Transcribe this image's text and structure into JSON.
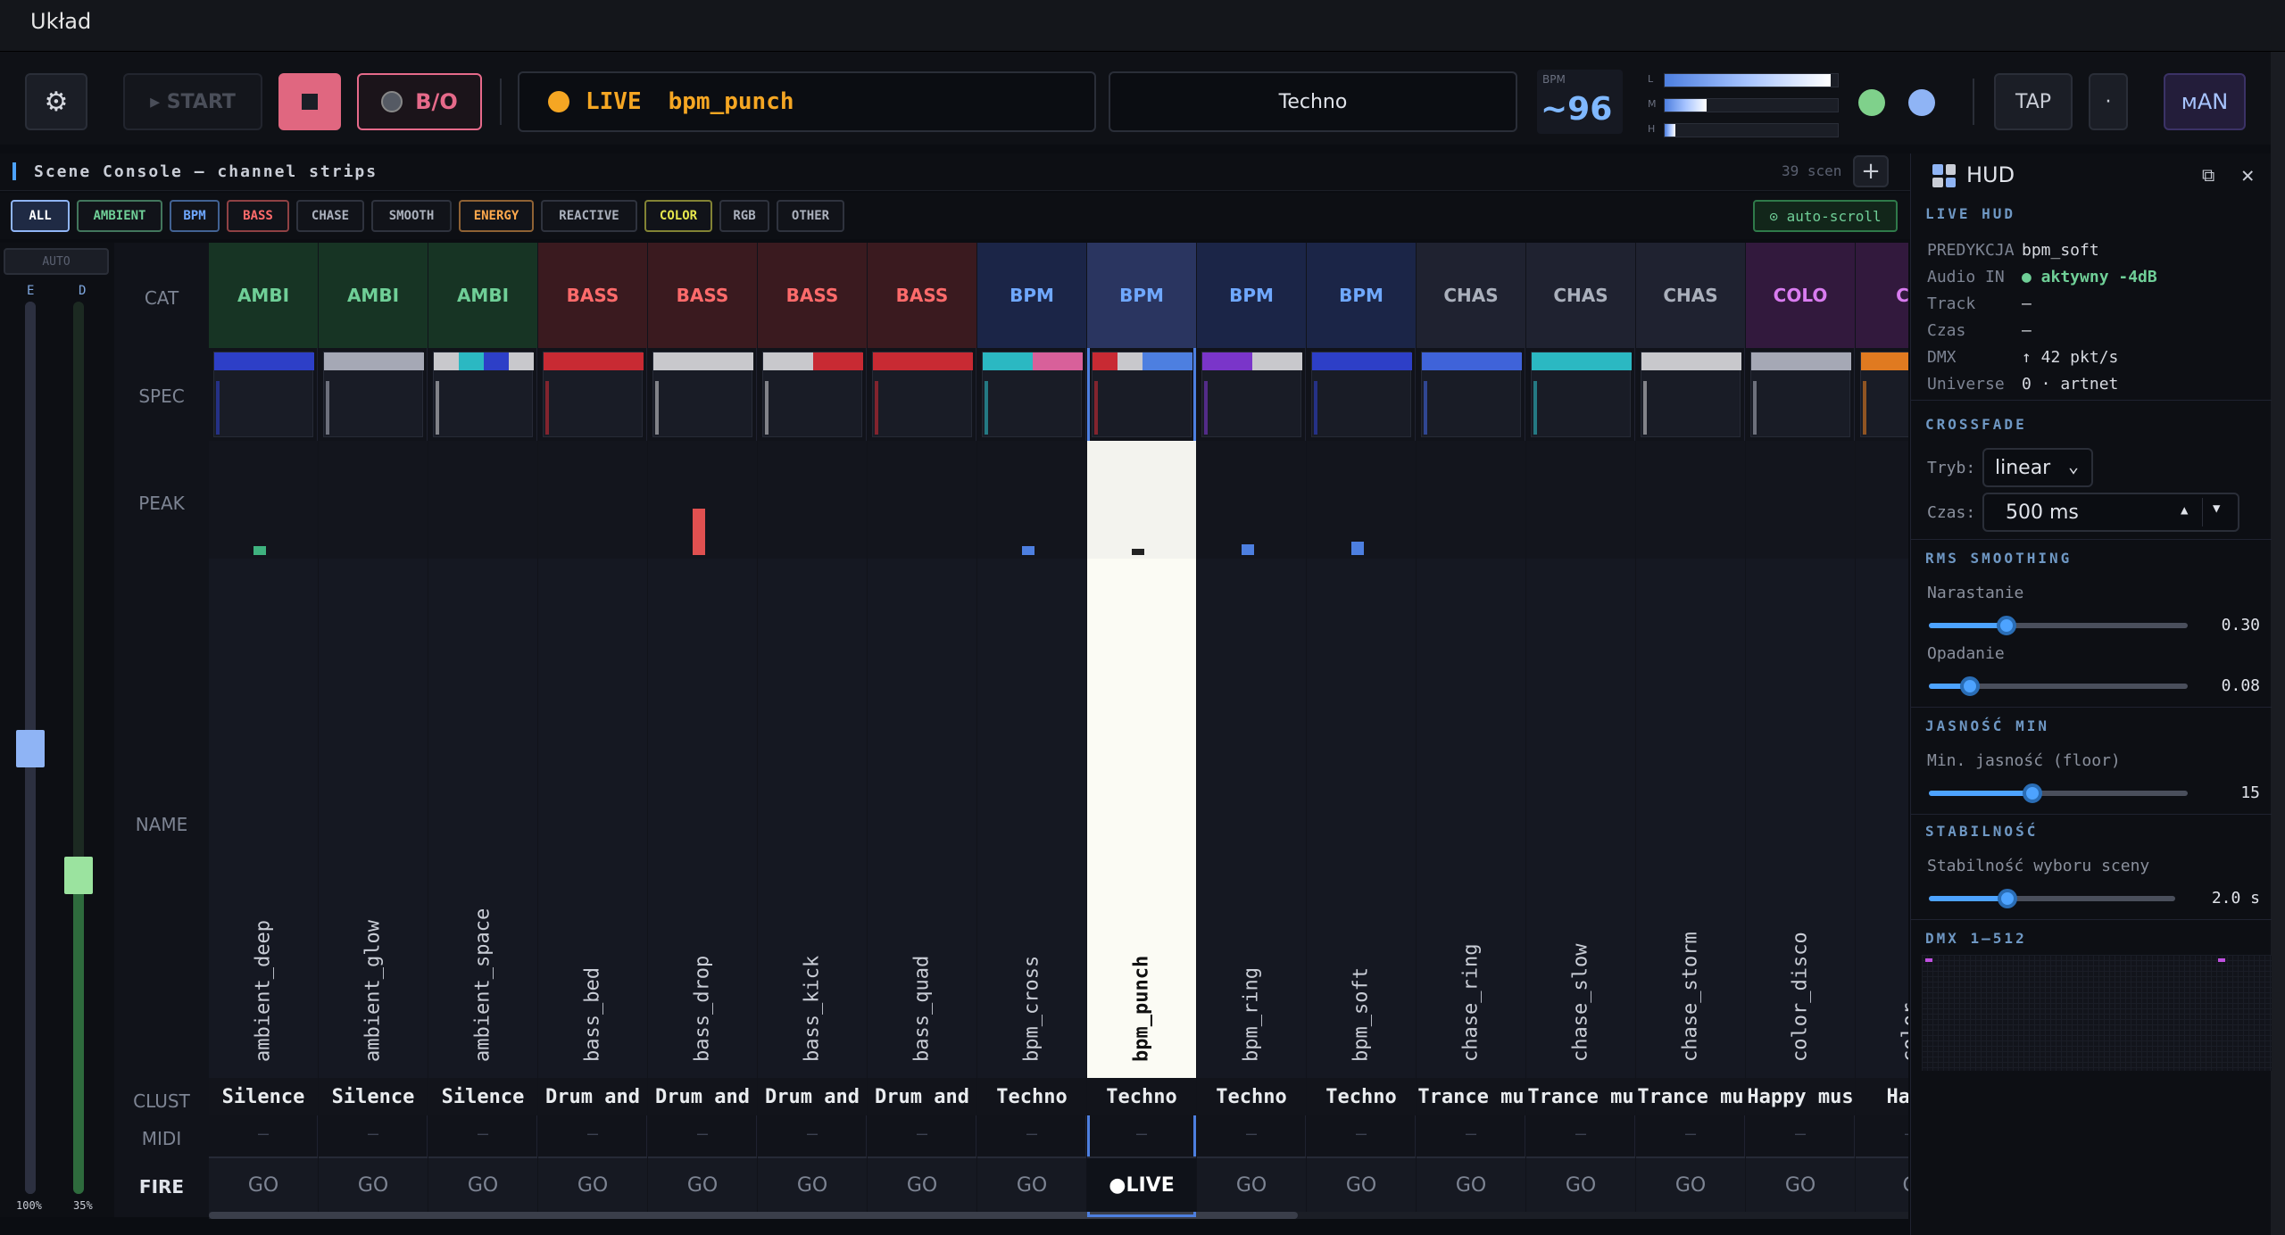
{
  "window": {
    "title": "Układ"
  },
  "toolbar": {
    "start_label": "▸ START",
    "bo_label": "B/O",
    "live_label": "LIVE",
    "live_scene": "bpm_punch",
    "genre": "Techno",
    "bpm_caption": "BPM",
    "bpm_value": "~96",
    "meters": [
      {
        "label": "L",
        "level": 0.96
      },
      {
        "label": "M",
        "level": 0.24
      },
      {
        "label": "H",
        "level": 0.06
      }
    ],
    "tap_label": "TAP",
    "dot_label": "·",
    "man_label": "ᴍAN",
    "colors": {
      "accent": "#4da3ff",
      "live": "#f5a623",
      "bo": "#e66a8a",
      "green": "#7fd18b",
      "blue": "#8fb4f5"
    }
  },
  "scene_console": {
    "title": "Scene Console — channel strips",
    "scene_count": "39 scen",
    "add_label": "+",
    "autoscroll_label": "⊙ auto-scroll",
    "filters": [
      {
        "label": "ALL",
        "color": "#ffffff"
      },
      {
        "label": "AMBIENT",
        "color": "#6fcf97"
      },
      {
        "label": "BPM",
        "color": "#6fa8ff"
      },
      {
        "label": "BASS",
        "color": "#ff6b6b"
      },
      {
        "label": "CHASE",
        "color": "#aab0bc"
      },
      {
        "label": "SMOOTH",
        "color": "#aab0bc"
      },
      {
        "label": "ENERGY",
        "color": "#ffa94d"
      },
      {
        "label": "REACTIVE",
        "color": "#aab0bc"
      },
      {
        "label": "COLOR",
        "color": "#e6e64d"
      },
      {
        "label": "RGB",
        "color": "#aab0bc"
      },
      {
        "label": "OTHER",
        "color": "#aab0bc"
      }
    ],
    "row_labels": {
      "cat": "CAT",
      "spec": "SPEC",
      "peak": "PEAK",
      "name": "NAME",
      "clust": "CLUST",
      "midi": "MIDI",
      "fire": "FIRE"
    },
    "left_meter": {
      "auto_label": "AUTO",
      "e_label": "E",
      "d_label": "D",
      "e_value": "100%",
      "d_value": "35%",
      "e_level": 1.0,
      "d_level": 0.35
    },
    "strips": [
      {
        "cat": "AMBI",
        "name": "ambient_deep",
        "clust": "Silence",
        "midi": "—",
        "fire": "GO",
        "peak": 0.08,
        "peak_color": "#3fb27f",
        "cat_color": "#6fcf97",
        "cat_bg": "#173424",
        "spec": [
          "#2d3fc7",
          "#2d3fc7",
          "#2d3fc7",
          "#2d3fc7"
        ]
      },
      {
        "cat": "AMBI",
        "name": "ambient_glow",
        "clust": "Silence",
        "midi": "—",
        "fire": "GO",
        "peak": 0,
        "peak_color": "#3fb27f",
        "cat_color": "#6fcf97",
        "cat_bg": "#173424",
        "spec": [
          "#a5a8b5",
          "#a5a8b5",
          "#a5a8b5",
          "#a5a8b5"
        ]
      },
      {
        "cat": "AMBI",
        "name": "ambient_space",
        "clust": "Silence",
        "midi": "—",
        "fire": "GO",
        "peak": 0,
        "peak_color": "#3fb27f",
        "cat_color": "#6fcf97",
        "cat_bg": "#173424",
        "spec": [
          "#c8c8cc",
          "#2bb8c2",
          "#2d3fc7",
          "#c8c8cc"
        ]
      },
      {
        "cat": "BASS",
        "name": "bass_bed",
        "clust": "Drum and",
        "midi": "—",
        "fire": "GO",
        "peak": 0,
        "peak_color": "#e05050",
        "cat_color": "#ff6b6b",
        "cat_bg": "#3a1a1f",
        "spec": [
          "#c82a33",
          "#c82a33",
          "#c82a33",
          "#c82a33"
        ]
      },
      {
        "cat": "BASS",
        "name": "bass_drop",
        "clust": "Drum and",
        "midi": "—",
        "fire": "GO",
        "peak": 0.42,
        "peak_color": "#e05050",
        "cat_color": "#ff6b6b",
        "cat_bg": "#3a1a1f",
        "spec": [
          "#c8c8cc",
          "#c8c8cc",
          "#c8c8cc",
          "#c8c8cc"
        ]
      },
      {
        "cat": "BASS",
        "name": "bass_kick",
        "clust": "Drum and",
        "midi": "—",
        "fire": "GO",
        "peak": 0,
        "peak_color": "#e05050",
        "cat_color": "#ff6b6b",
        "cat_bg": "#3a1a1f",
        "spec": [
          "#c8c8cc",
          "#c8c8cc",
          "#c82a33",
          "#c82a33"
        ]
      },
      {
        "cat": "BASS",
        "name": "bass_quad",
        "clust": "Drum and",
        "midi": "—",
        "fire": "GO",
        "peak": 0,
        "peak_color": "#e05050",
        "cat_color": "#ff6b6b",
        "cat_bg": "#3a1a1f",
        "spec": [
          "#c82a33",
          "#c82a33",
          "#c82a33",
          "#c82a33"
        ]
      },
      {
        "cat": "BPM",
        "name": "bpm_cross",
        "clust": "Techno",
        "midi": "—",
        "fire": "GO",
        "peak": 0.08,
        "peak_color": "#4d7fe0",
        "cat_color": "#6fa8ff",
        "cat_bg": "#1b2547",
        "spec": [
          "#2bb8c2",
          "#2bb8c2",
          "#d8609a",
          "#d8609a"
        ]
      },
      {
        "cat": "BPM",
        "name": "bpm_punch",
        "clust": "Techno",
        "midi": "—",
        "fire": "●LIVE",
        "peak": 0.06,
        "peak_color": "#222222",
        "cat_color": "#6fa8ff",
        "cat_bg": "#2a3560",
        "spec": [
          "#c82a33",
          "#c8c8cc",
          "#4d7fe0",
          "#4d7fe0"
        ],
        "live": true
      },
      {
        "cat": "BPM",
        "name": "bpm_ring",
        "clust": "Techno",
        "midi": "—",
        "fire": "GO",
        "peak": 0.1,
        "peak_color": "#4d7fe0",
        "cat_color": "#6fa8ff",
        "cat_bg": "#1b2547",
        "spec": [
          "#7a35c9",
          "#7a35c9",
          "#c8c8cc",
          "#c8c8cc"
        ]
      },
      {
        "cat": "BPM",
        "name": "bpm_soft",
        "clust": "Techno",
        "midi": "—",
        "fire": "GO",
        "peak": 0.12,
        "peak_color": "#4d7fe0",
        "cat_color": "#6fa8ff",
        "cat_bg": "#1b2547",
        "spec": [
          "#2d3fc7",
          "#2d3fc7",
          "#2d3fc7",
          "#2d3fc7"
        ]
      },
      {
        "cat": "CHAS",
        "name": "chase_ring",
        "clust": "Trance mu",
        "midi": "—",
        "fire": "GO",
        "peak": 0,
        "peak_color": "#8a8fa0",
        "cat_color": "#aab0bc",
        "cat_bg": "#1f2230",
        "spec": [
          "#3f63d9",
          "#3f63d9",
          "#3f63d9",
          "#3f63d9"
        ]
      },
      {
        "cat": "CHAS",
        "name": "chase_slow",
        "clust": "Trance mu",
        "midi": "—",
        "fire": "GO",
        "peak": 0,
        "peak_color": "#8a8fa0",
        "cat_color": "#aab0bc",
        "cat_bg": "#1f2230",
        "spec": [
          "#2bb8c2",
          "#2bb8c2",
          "#2bb8c2",
          "#2bb8c2"
        ]
      },
      {
        "cat": "CHAS",
        "name": "chase_storm",
        "clust": "Trance mu",
        "midi": "—",
        "fire": "GO",
        "peak": 0,
        "peak_color": "#8a8fa0",
        "cat_color": "#aab0bc",
        "cat_bg": "#1f2230",
        "spec": [
          "#c8c8cc",
          "#c8c8cc",
          "#c8c8cc",
          "#c8c8cc"
        ]
      },
      {
        "cat": "COLO",
        "name": "color_disco",
        "clust": "Happy mus",
        "midi": "—",
        "fire": "GO",
        "peak": 0,
        "peak_color": "#c050e0",
        "cat_color": "#d97cf0",
        "cat_bg": "#32193d",
        "spec": [
          "#a5a8b5",
          "#a5a8b5",
          "#a5a8b5",
          "#a5a8b5"
        ]
      },
      {
        "cat": "CO",
        "name": "color_",
        "clust": "Happ",
        "midi": "—",
        "fire": "G",
        "peak": 0,
        "peak_color": "#c050e0",
        "cat_color": "#d97cf0",
        "cat_bg": "#32193d",
        "spec": [
          "#e07a20",
          "#e07a20",
          "#8a2bbf",
          "#8a2bbf"
        ]
      }
    ]
  },
  "hud": {
    "title": "HUD",
    "live_hud_title": "LIVE HUD",
    "info": [
      {
        "key": "PREDYKCJA",
        "value": "bpm_soft"
      },
      {
        "key": "Audio IN",
        "value": "● aktywny  -4dB"
      },
      {
        "key": "Track",
        "value": "—"
      },
      {
        "key": "Czas",
        "value": "—"
      },
      {
        "key": "DMX",
        "value": "↑ 42 pkt/s"
      },
      {
        "key": "Universe",
        "value": "0 · artnet"
      }
    ],
    "crossfade": {
      "title": "CROSSFADE",
      "mode_label": "Tryb:",
      "mode_value": "linear",
      "time_label": "Czas:",
      "time_value": "500 ms"
    },
    "rms": {
      "title": "RMS SMOOTHING",
      "rise_label": "Narastanie",
      "rise_value": "0.30",
      "rise_level": 0.3,
      "fall_label": "Opadanie",
      "fall_value": "0.08",
      "fall_level": 0.16
    },
    "brightness": {
      "title": "JASNOŚĆ MIN",
      "label": "Min. jasność (floor)",
      "value": "15",
      "level": 0.4
    },
    "stability": {
      "title": "STABILNOŚĆ",
      "label": "Stabilność wyboru sceny",
      "value": "2.0 s",
      "level": 0.32
    },
    "dmx_title": "DMX 1–512"
  }
}
